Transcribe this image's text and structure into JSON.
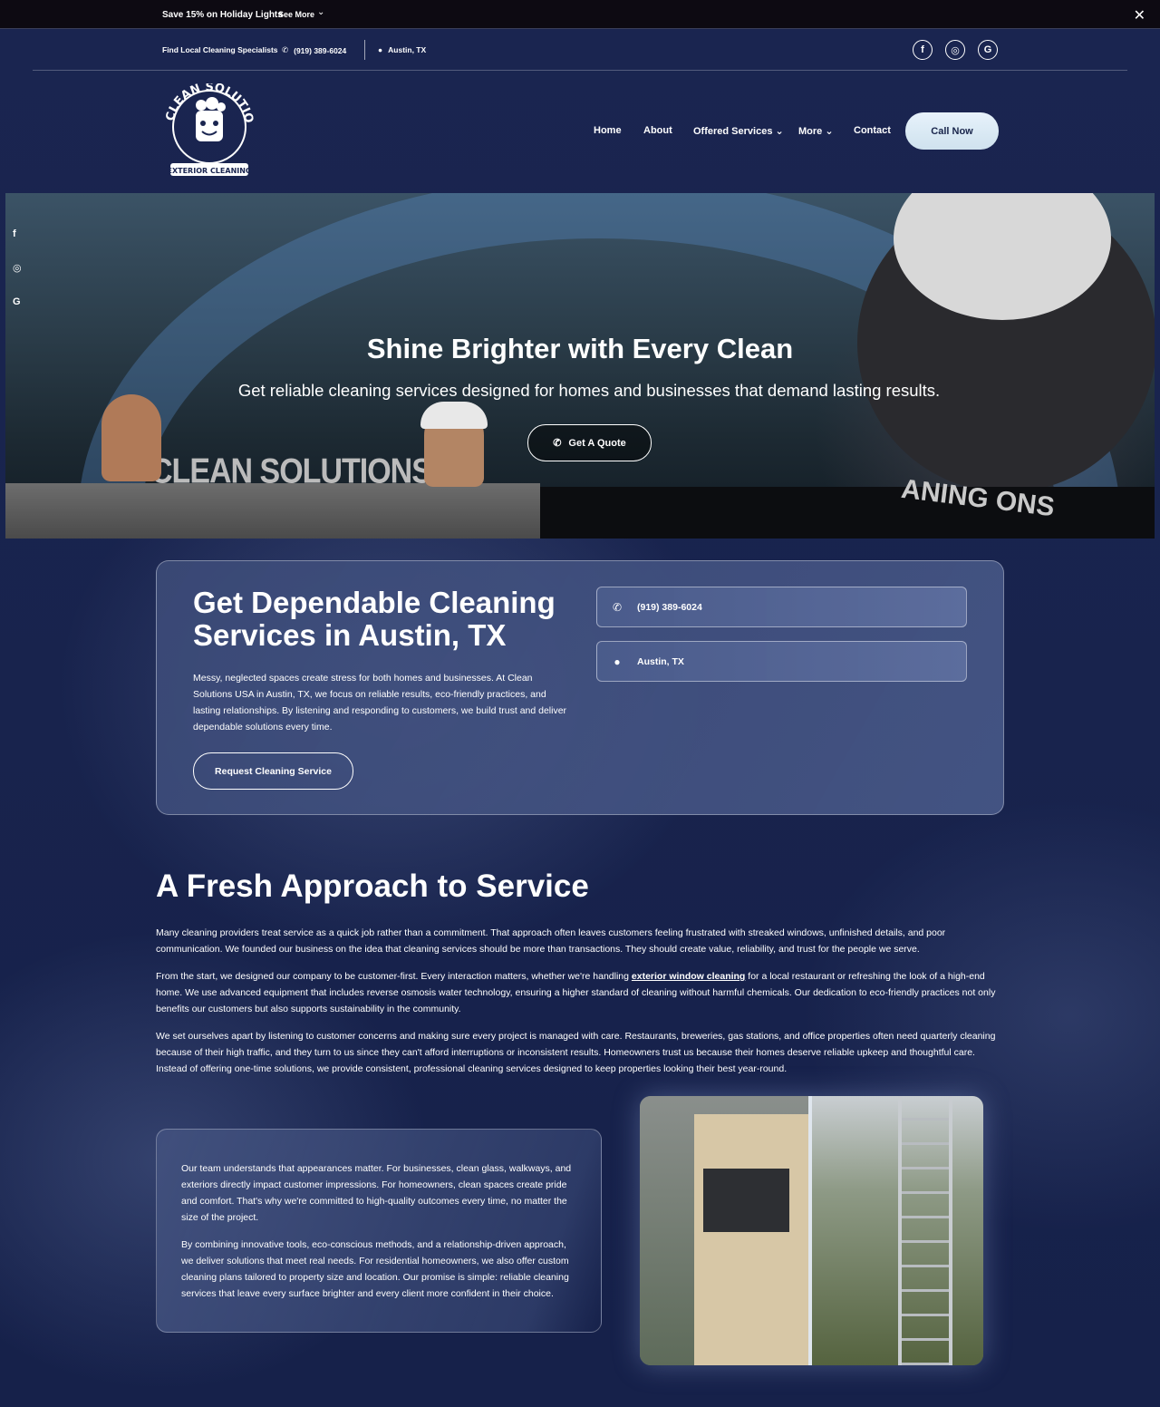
{
  "announcement": {
    "promo": "Save 15% on Holiday Lights",
    "see_more": "See More",
    "close_label": "✕"
  },
  "topbar": {
    "tagline": "Find Local Cleaning Specialists",
    "phone": "(919) 389-6024",
    "location": "Austin, TX",
    "socials": [
      "facebook-icon",
      "instagram-icon",
      "google-icon"
    ]
  },
  "header": {
    "logo_alt": "Clean Solutions Exterior Cleaning",
    "nav": {
      "home": "Home",
      "about": "About",
      "services": "Offered Services",
      "more": "More",
      "contact": "Contact"
    },
    "cta": "Call Now"
  },
  "hero": {
    "title": "Shine Brighter with Every Clean",
    "subtitle": "Get reliable cleaning services designed for homes and businesses that demand lasting results.",
    "cta": "Get A Quote",
    "truck_text": "CLEAN SOLUTIONS",
    "shirt_text": "ANING  ONS"
  },
  "intro_card": {
    "title": "Get Dependable Cleaning Services in Austin, TX",
    "body": "Messy, neglected spaces create stress for both homes and businesses. At Clean Solutions USA in Austin, TX, we focus on reliable results, eco-friendly practices, and lasting relationships. By listening and responding to customers, we build trust and deliver dependable solutions every time.",
    "cta": "Request Cleaning Service",
    "phone": "(919) 389-6024",
    "location": "Austin, TX"
  },
  "approach": {
    "title": "A Fresh Approach to Service",
    "p1": "Many cleaning providers treat service as a quick job rather than a commitment. That approach often leaves customers feeling frustrated with streaked windows, unfinished details, and poor communication. We founded our business on the idea that cleaning services should be more than transactions. They should create value, reliability, and trust for the people we serve.",
    "p2_before": "From the start, we designed our company to be customer-first. Every interaction matters, whether we're handling ",
    "p2_link": "exterior window cleaning",
    "p2_after": " for a local restaurant or refreshing the look of a high-end home. We use advanced equipment that includes reverse osmosis water technology, ensuring a higher standard of cleaning without harmful chemicals. Our dedication to eco-friendly practices not only benefits our customers but also supports sustainability in the community.",
    "p3": "We set ourselves apart by listening to customer concerns and making sure every project is managed with care. Restaurants, breweries, gas stations, and office properties often need quarterly cleaning because of their high traffic, and they turn to us since they can't afford interruptions or inconsistent results. Homeowners trust us because their homes deserve reliable upkeep and thoughtful care. Instead of offering one-time solutions, we provide consistent, professional cleaning services designed to keep properties looking their best year-round."
  },
  "team_card": {
    "p1": "Our team understands that appearances matter. For businesses, clean glass, walkways, and exteriors directly impact customer impressions. For homeowners, clean spaces create pride and comfort. That's why we're committed to high-quality outcomes every time, no matter the size of the project.",
    "p2": "By combining innovative tools, eco-conscious methods, and a relationship-driven approach, we deliver solutions that meet real needs. For residential homeowners, we also offer custom cleaning plans tailored to property size and location. Our promise is simple: reliable cleaning services that leave every surface brighter and every client more confident in their choice."
  },
  "colors": {
    "page_bg": "#17224a",
    "announce_bg": "#0d0a12",
    "card_bg": "#3c4b78",
    "cta_bg": "#e7f2fb",
    "cta_text": "#18244a"
  }
}
